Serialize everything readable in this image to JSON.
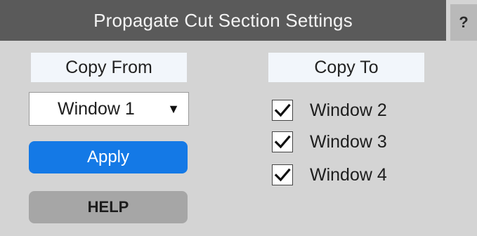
{
  "window": {
    "title": "Propagate Cut Section Settings",
    "help_glyph": "?"
  },
  "copy_from": {
    "label": "Copy From",
    "selected": "Window 1",
    "arrow_icon": "triangle-down-icon"
  },
  "copy_to": {
    "label": "Copy To",
    "items": [
      {
        "label": "Window 2",
        "checked": true
      },
      {
        "label": "Window 3",
        "checked": true
      },
      {
        "label": "Window 4",
        "checked": true
      }
    ]
  },
  "buttons": {
    "apply": "Apply",
    "help": "HELP"
  },
  "colors": {
    "titlebar": "#5a5a5a",
    "panel": "#d4d4d4",
    "apply": "#1479e6",
    "help": "#a6a6a6",
    "label_bg": "#f2f6fb"
  }
}
